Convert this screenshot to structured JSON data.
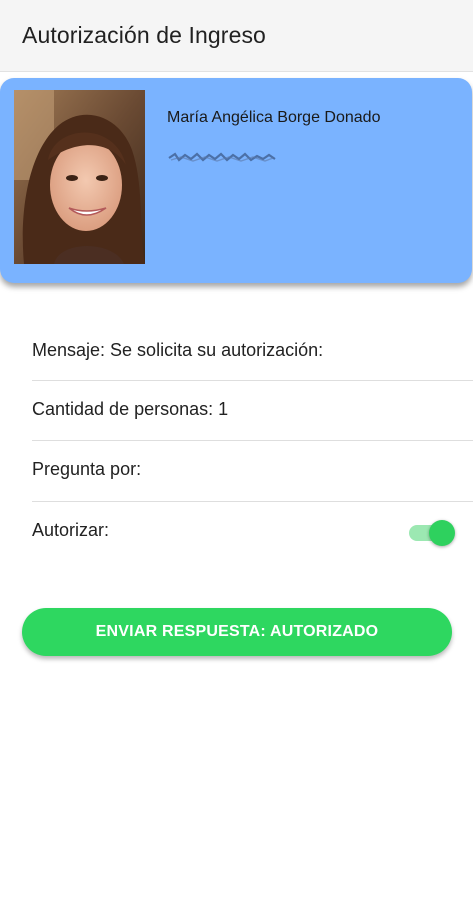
{
  "appbar": {
    "title": "Autorización de Ingreso"
  },
  "visitor_card": {
    "name": "María Angélica Borge Donado",
    "background_color": "#7ab3ff"
  },
  "details": {
    "message_label": "Mensaje: Se solicita su autorización:",
    "people_count_label": "Cantidad de personas: 1",
    "ask_for_label": "Pregunta por:",
    "authorize_label": "Autorizar:",
    "authorize_toggle_on": true
  },
  "actions": {
    "send_label": "ENVIAR RESPUESTA: AUTORIZADO",
    "send_color": "#2ed760"
  }
}
